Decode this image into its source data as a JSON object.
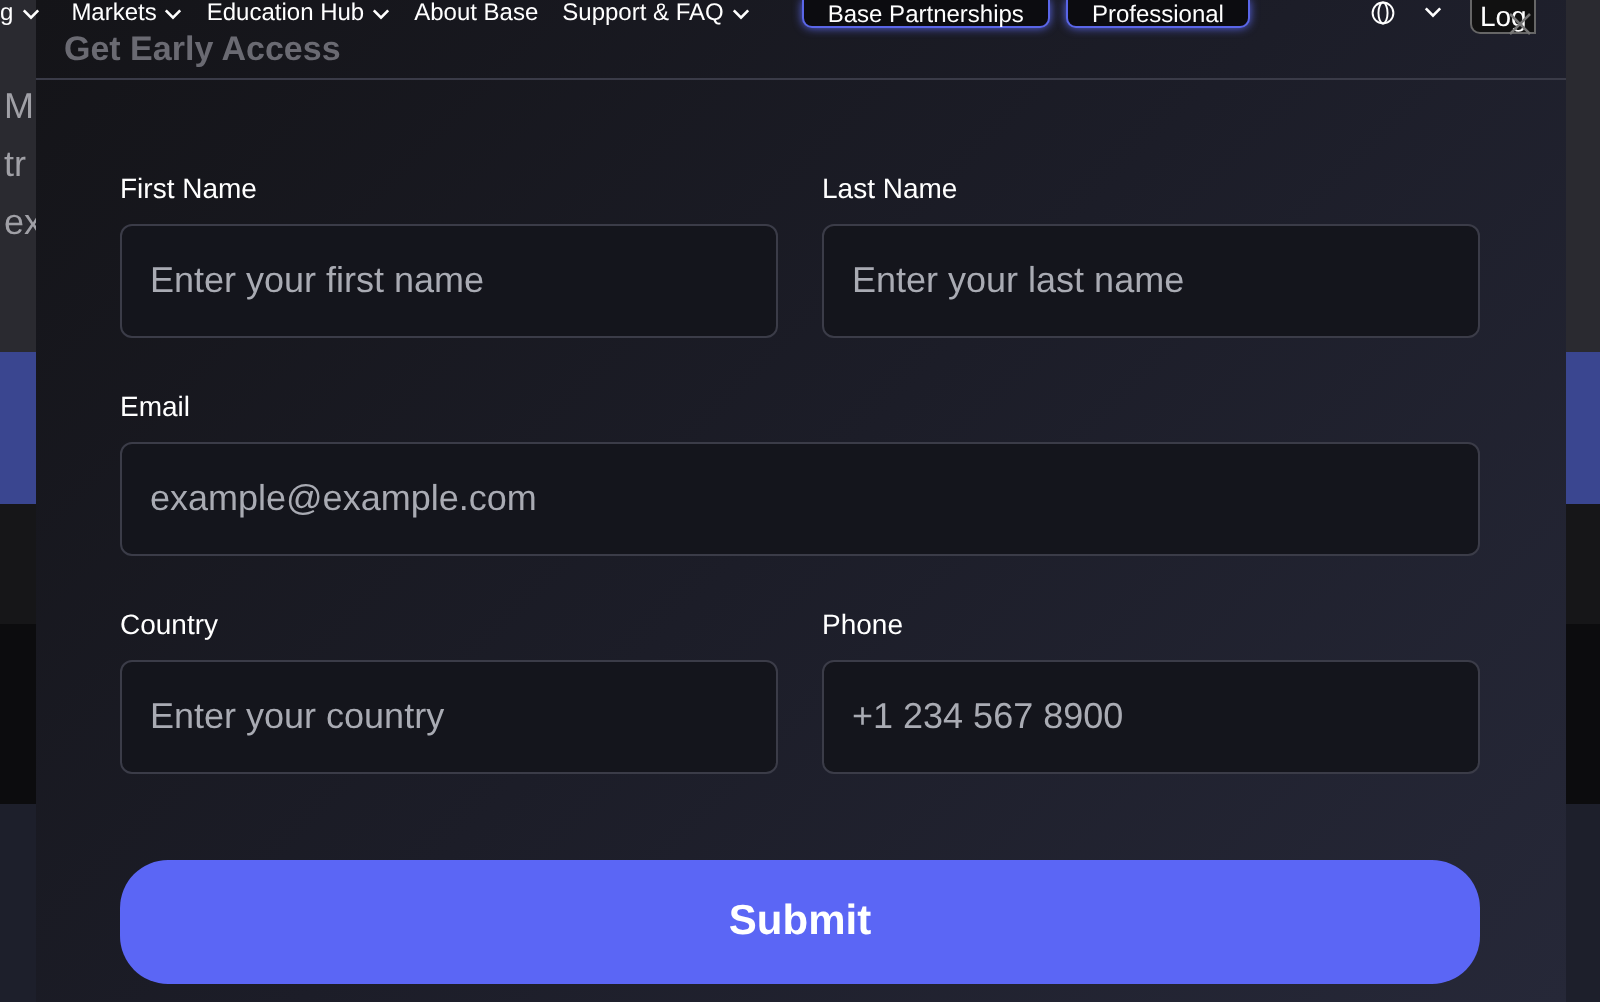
{
  "nav": {
    "items": [
      {
        "label": "g",
        "dropdown": true
      },
      {
        "label": "Markets",
        "dropdown": true
      },
      {
        "label": "Education Hub",
        "dropdown": true
      },
      {
        "label": "About Base",
        "dropdown": false
      },
      {
        "label": "Support & FAQ",
        "dropdown": true
      }
    ],
    "buttons": [
      "Base Partnerships",
      "Professional"
    ],
    "login": "Log"
  },
  "background_text": [
    "M",
    "tr",
    "ex"
  ],
  "modal": {
    "title": "Get Early Access",
    "field_rows": [
      [
        {
          "label": "First Name",
          "placeholder": "Enter your first name"
        },
        {
          "label": "Last Name",
          "placeholder": "Enter your last name"
        }
      ],
      [
        {
          "label": "Email",
          "placeholder": "example@example.com"
        }
      ],
      [
        {
          "label": "Country",
          "placeholder": "Enter your country"
        },
        {
          "label": "Phone",
          "placeholder": "+1 234 567 8900"
        }
      ]
    ],
    "submit": "Submit"
  }
}
